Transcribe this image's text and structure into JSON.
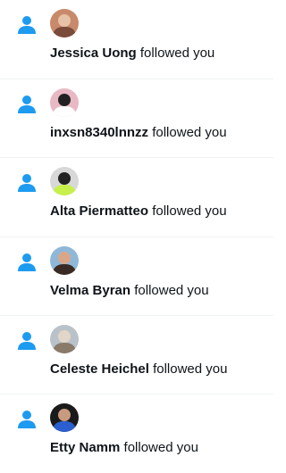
{
  "accent_color": "#1d9bf0",
  "divider_color": "#eff3f4",
  "notifications": [
    {
      "name": "Jessica Uong",
      "action": "followed you",
      "icon": "person-icon",
      "avatar_colors": [
        "#c88a6a",
        "#7a4a3a",
        "#e6c3a8"
      ]
    },
    {
      "name": "inxsn8340lnnzz",
      "action": "followed you",
      "icon": "person-icon",
      "avatar_colors": [
        "#e8b9c4",
        "#ffffff",
        "#222222"
      ]
    },
    {
      "name": "Alta Piermatteo",
      "action": "followed you",
      "icon": "person-icon",
      "avatar_colors": [
        "#d8d8d8",
        "#c7f04a",
        "#222222"
      ]
    },
    {
      "name": "Velma Byran",
      "action": "followed you",
      "icon": "person-icon",
      "avatar_colors": [
        "#8fb8d8",
        "#3a2a24",
        "#d9a788"
      ]
    },
    {
      "name": "Celeste Heichel",
      "action": "followed you",
      "icon": "person-icon",
      "avatar_colors": [
        "#b9c2c8",
        "#8a7a6a",
        "#e2d6c8"
      ]
    },
    {
      "name": "Etty Namm",
      "action": "followed you",
      "icon": "person-icon",
      "avatar_colors": [
        "#1a1a1a",
        "#2b5fcf",
        "#c89a80"
      ]
    }
  ]
}
